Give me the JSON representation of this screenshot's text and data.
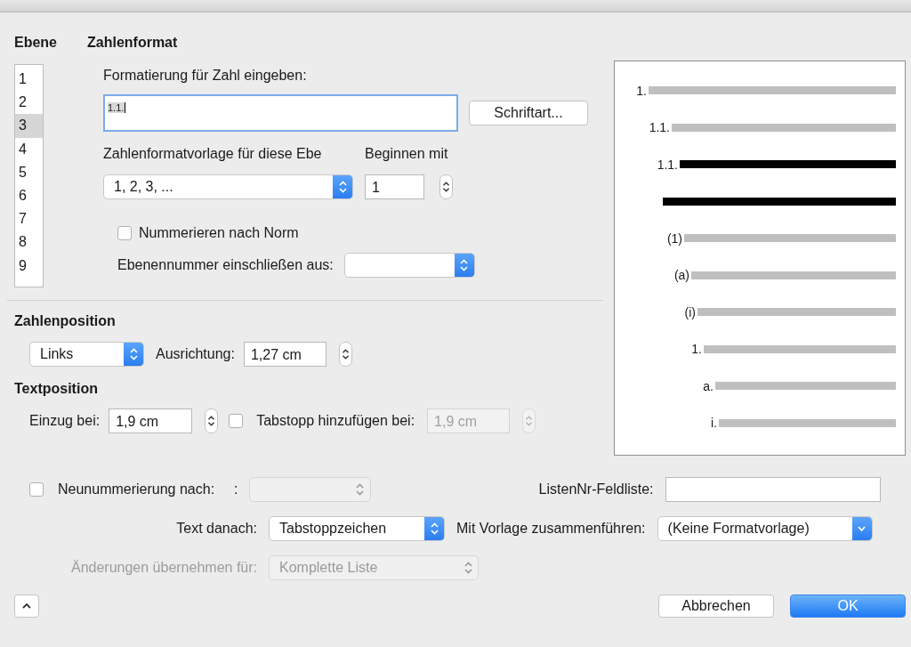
{
  "level_heading": "Ebene",
  "levels": [
    {
      "label": "1",
      "selected": false
    },
    {
      "label": "2",
      "selected": false
    },
    {
      "label": "3",
      "selected": true
    },
    {
      "label": "4",
      "selected": false
    },
    {
      "label": "5",
      "selected": false
    },
    {
      "label": "6",
      "selected": false
    },
    {
      "label": "7",
      "selected": false
    },
    {
      "label": "8",
      "selected": false
    },
    {
      "label": "9",
      "selected": false
    }
  ],
  "number_format": {
    "heading": "Zahlenformat",
    "format_label": "Formatierung für Zahl eingeben:",
    "format_value": "1.1.",
    "font_button": "Schriftart...",
    "style_label": "Zahlenformatvorlage für diese Ebe",
    "style_value": "1, 2, 3, ...",
    "start_label": "Beginnen mit",
    "start_value": "1",
    "legal_checkbox": {
      "label": "Nummerieren nach Norm",
      "checked": false
    },
    "include_label": "Ebenennummer einschließen aus:"
  },
  "number_position": {
    "heading": "Zahlenposition",
    "alignment_value": "Links",
    "aligned_at_label": "Ausrichtung:",
    "aligned_at_value": "1,27 cm"
  },
  "text_position": {
    "heading": "Textposition",
    "indent_label": "Einzug bei:",
    "indent_value": "1,9 cm",
    "tab_checkbox": {
      "label": "Tabstopp hinzufügen bei:",
      "checked": false
    },
    "tab_value": "1,9 cm",
    "tab_disabled": true
  },
  "preview": [
    {
      "label": "1.",
      "selected": false
    },
    {
      "label": "1.1.",
      "selected": false
    },
    {
      "label": "1.1.",
      "selected": true
    },
    {
      "selected": true
    },
    {
      "label": "(1)",
      "selected": false
    },
    {
      "label": "(a)",
      "selected": false
    },
    {
      "label": "(i)",
      "selected": false
    },
    {
      "label": "1.",
      "selected": false
    },
    {
      "label": "a.",
      "selected": false
    },
    {
      "label": "i.",
      "selected": false
    }
  ],
  "restart": {
    "label": "Neunummerierung nach:",
    "colon": ":",
    "checked": false,
    "disabled": true
  },
  "listnum_label": "ListenNr-Feldliste:",
  "follow_label": "Text danach:",
  "follow_value": "Tabstoppzeichen",
  "link_label": "Mit Vorlage zusammenführen:",
  "link_value": "(Keine Formatvorlage)",
  "apply": {
    "label": "Änderungen übernehmen für:",
    "value": "Komplette Liste",
    "disabled": true
  },
  "buttons": [
    {
      "label": "Abbrechen",
      "kind": "secondary"
    },
    {
      "label": "OK",
      "kind": "default"
    }
  ]
}
